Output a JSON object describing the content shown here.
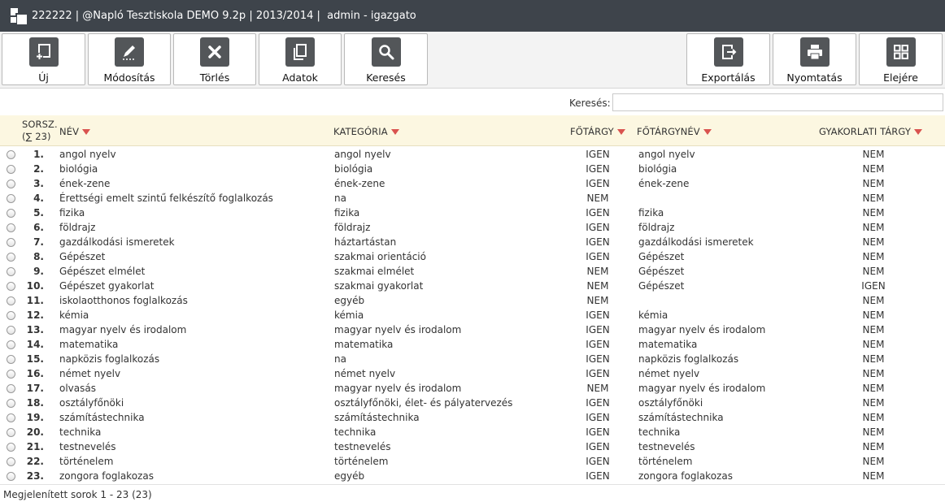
{
  "titlebar": {
    "title": "222222 | @Napló Tesztiskola DEMO 9.2p | 2013/2014 |  admin - igazgato"
  },
  "toolbar": {
    "new_label": "Új",
    "edit_label": "Módosítás",
    "delete_label": "Törlés",
    "data_label": "Adatok",
    "search_label": "Keresés",
    "export_label": "Exportálás",
    "print_label": "Nyomtatás",
    "top_label": "Elejére"
  },
  "search": {
    "label": "Keresés:",
    "value": ""
  },
  "table": {
    "headers": {
      "sorsz_line1": "SORSZ.",
      "sorsz_line2": "(∑ 23)",
      "name": "NÉV",
      "category": "KATEGÓRIA",
      "fotargy": "FŐTÁRGY",
      "fotargynev": "FŐTÁRGYNÉV",
      "gyakorlati": "GYAKORLATI TÁRGY"
    },
    "rows": [
      {
        "num": "1.",
        "name": "angol nyelv",
        "category": "angol nyelv",
        "fotargy": "IGEN",
        "fotargynev": "angol nyelv",
        "gyakorlati": "NEM"
      },
      {
        "num": "2.",
        "name": "biológia",
        "category": "biológia",
        "fotargy": "IGEN",
        "fotargynev": "biológia",
        "gyakorlati": "NEM"
      },
      {
        "num": "3.",
        "name": "ének-zene",
        "category": "ének-zene",
        "fotargy": "IGEN",
        "fotargynev": "ének-zene",
        "gyakorlati": "NEM"
      },
      {
        "num": "4.",
        "name": "Érettségi emelt szintű felkészítő foglalkozás",
        "category": "na",
        "fotargy": "NEM",
        "fotargynev": "",
        "gyakorlati": "NEM"
      },
      {
        "num": "5.",
        "name": "fizika",
        "category": "fizika",
        "fotargy": "IGEN",
        "fotargynev": "fizika",
        "gyakorlati": "NEM"
      },
      {
        "num": "6.",
        "name": "földrajz",
        "category": "földrajz",
        "fotargy": "IGEN",
        "fotargynev": "földrajz",
        "gyakorlati": "NEM"
      },
      {
        "num": "7.",
        "name": "gazdálkodási ismeretek",
        "category": "háztartástan",
        "fotargy": "IGEN",
        "fotargynev": "gazdálkodási ismeretek",
        "gyakorlati": "NEM"
      },
      {
        "num": "8.",
        "name": "Gépészet",
        "category": "szakmai orientáció",
        "fotargy": "IGEN",
        "fotargynev": "Gépészet",
        "gyakorlati": "NEM"
      },
      {
        "num": "9.",
        "name": "Gépészet elmélet",
        "category": "szakmai elmélet",
        "fotargy": "NEM",
        "fotargynev": "Gépészet",
        "gyakorlati": "NEM"
      },
      {
        "num": "10.",
        "name": "Gépészet gyakorlat",
        "category": "szakmai gyakorlat",
        "fotargy": "NEM",
        "fotargynev": "Gépészet",
        "gyakorlati": "IGEN"
      },
      {
        "num": "11.",
        "name": "iskolaotthonos foglalkozás",
        "category": "egyéb",
        "fotargy": "NEM",
        "fotargynev": "",
        "gyakorlati": "NEM"
      },
      {
        "num": "12.",
        "name": "kémia",
        "category": "kémia",
        "fotargy": "IGEN",
        "fotargynev": "kémia",
        "gyakorlati": "NEM"
      },
      {
        "num": "13.",
        "name": "magyar nyelv és irodalom",
        "category": "magyar nyelv és irodalom",
        "fotargy": "IGEN",
        "fotargynev": "magyar nyelv és irodalom",
        "gyakorlati": "NEM"
      },
      {
        "num": "14.",
        "name": "matematika",
        "category": "matematika",
        "fotargy": "IGEN",
        "fotargynev": "matematika",
        "gyakorlati": "NEM"
      },
      {
        "num": "15.",
        "name": "napközis foglalkozás",
        "category": "na",
        "fotargy": "IGEN",
        "fotargynev": "napközis foglalkozás",
        "gyakorlati": "NEM"
      },
      {
        "num": "16.",
        "name": "német nyelv",
        "category": "német nyelv",
        "fotargy": "IGEN",
        "fotargynev": "német nyelv",
        "gyakorlati": "NEM"
      },
      {
        "num": "17.",
        "name": "olvasás",
        "category": "magyar nyelv és irodalom",
        "fotargy": "NEM",
        "fotargynev": "magyar nyelv és irodalom",
        "gyakorlati": "NEM"
      },
      {
        "num": "18.",
        "name": "osztályfőnöki",
        "category": "osztályfőnöki, élet- és pályatervezés",
        "fotargy": "IGEN",
        "fotargynev": "osztályfőnöki",
        "gyakorlati": "NEM"
      },
      {
        "num": "19.",
        "name": "számítástechnika",
        "category": "számítástechnika",
        "fotargy": "IGEN",
        "fotargynev": "számítástechnika",
        "gyakorlati": "NEM"
      },
      {
        "num": "20.",
        "name": "technika",
        "category": "technika",
        "fotargy": "IGEN",
        "fotargynev": "technika",
        "gyakorlati": "NEM"
      },
      {
        "num": "21.",
        "name": "testnevelés",
        "category": "testnevelés",
        "fotargy": "IGEN",
        "fotargynev": "testnevelés",
        "gyakorlati": "NEM"
      },
      {
        "num": "22.",
        "name": "történelem",
        "category": "történelem",
        "fotargy": "IGEN",
        "fotargynev": "történelem",
        "gyakorlati": "NEM"
      },
      {
        "num": "23.",
        "name": "zongora foglakozas",
        "category": "egyéb",
        "fotargy": "IGEN",
        "fotargynev": "zongora foglakozas",
        "gyakorlati": "NEM"
      }
    ]
  },
  "footer": {
    "text": "Megjelenített sorok 1 - 23 (23)"
  },
  "colors": {
    "titlebar_bg": "#3e444b",
    "header_bg": "#fcf7e1",
    "sort_arrow": "#d9534f",
    "icon_bg": "#535659"
  },
  "icons": {
    "logo": "app-logo-icon",
    "new": "new-document-icon",
    "edit": "pencil-icon",
    "delete": "x-icon",
    "data": "copy-icon",
    "search": "magnifier-icon",
    "export": "export-icon",
    "print": "printer-icon",
    "top": "grid-icon"
  }
}
